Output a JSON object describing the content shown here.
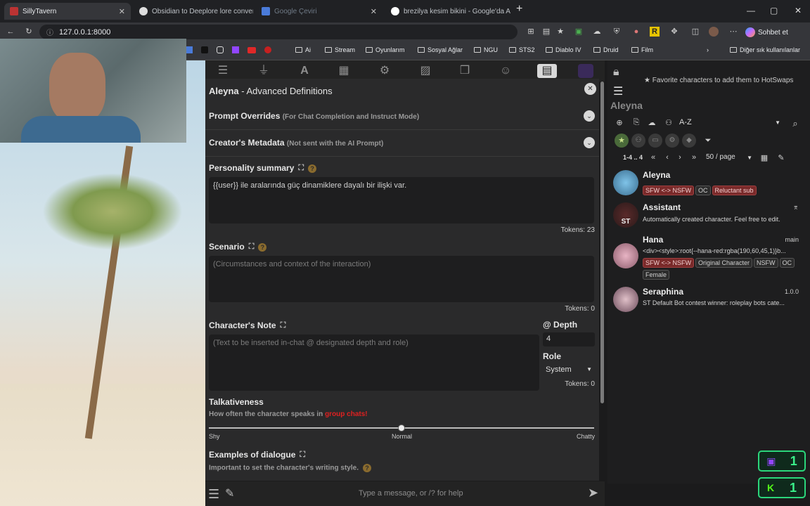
{
  "browser": {
    "tabs": [
      {
        "label": "SillyTavern",
        "active": true
      },
      {
        "label": "Obsidian to Deeplore lore convers",
        "active": false
      },
      {
        "label": "Google Çeviri",
        "active": false
      },
      {
        "label": "brezilya kesim bikini - Google'da A",
        "active": false
      }
    ],
    "url": "127.0.0.1:8000",
    "chat_button": "Sohbet et",
    "bookmarks": [
      "Ai",
      "Stream",
      "Oyunlarım",
      "Sosyal Ağlar",
      "NGU",
      "STS2",
      "Diablo IV",
      "Druid",
      "Film"
    ],
    "other_bookmarks": "Diğer sık kullanılanlar"
  },
  "editor": {
    "char_name": "Aleyna",
    "title_suffix": " - Advanced Definitions",
    "prompt_overrides": {
      "label": "Prompt Overrides",
      "sub": "(For Chat Completion and Instruct Mode)"
    },
    "creator_metadata": {
      "label": "Creator's Metadata",
      "sub": "(Not sent with the AI Prompt)"
    },
    "personality": {
      "label": "Personality summary",
      "value": "{{user}} ile aralarında güç dinamiklere dayalı bir ilişki var.",
      "tokens": "Tokens: 23"
    },
    "scenario": {
      "label": "Scenario",
      "placeholder": "(Circumstances and context of the interaction)",
      "tokens": "Tokens: 0"
    },
    "note": {
      "label": "Character's Note",
      "placeholder": "(Text to be inserted in-chat @ designated depth and role)",
      "tokens": "Tokens: 0"
    },
    "depth": {
      "label": "@ Depth",
      "value": "4"
    },
    "role": {
      "label": "Role",
      "value": "System"
    },
    "talkativeness": {
      "label": "Talkativeness",
      "hint": "How often the character speaks in ",
      "hint_link": "group chats!",
      "value": 0.5,
      "min_label": "Shy",
      "mid_label": "Normal",
      "max_label": "Chatty"
    },
    "examples": {
      "label": "Examples of dialogue",
      "hint": "Important to set the character's writing style."
    }
  },
  "chat_input": {
    "placeholder": "Type a message, or /? for help"
  },
  "right_panel": {
    "hotswap_hint": "Favorite characters to add them to HotSwaps",
    "current_name": "Aleyna",
    "sort": "A-Z",
    "pager": {
      "range": "1-4 .. 4",
      "per_page": "50 / page"
    },
    "characters": [
      {
        "name": "Aleyna",
        "desc": "",
        "tags": [
          {
            "label": "SFW <-> NSFW",
            "red": true
          },
          {
            "label": "OC",
            "red": false
          },
          {
            "label": "Reluctant sub",
            "red": true
          }
        ],
        "version": ""
      },
      {
        "name": "Assistant",
        "desc": "Automatically created character. Feel free to edit.",
        "tags": [],
        "version": ""
      },
      {
        "name": "Hana",
        "desc": "<div><style>:root{--hana-red:rgba(190,60,45,1)}b...",
        "tags": [
          {
            "label": "SFW <-> NSFW",
            "red": true
          },
          {
            "label": "Original Character",
            "red": false
          },
          {
            "label": "NSFW",
            "red": false
          },
          {
            "label": "OC",
            "red": false
          },
          {
            "label": "Female",
            "red": false
          }
        ],
        "version": "main"
      },
      {
        "name": "Seraphina",
        "desc": "ST Default Bot contest winner: roleplay bots cate...",
        "tags": [],
        "version": "1.0.0"
      }
    ]
  },
  "stream_widgets": [
    {
      "platform": "twitch-icon",
      "count": "1"
    },
    {
      "platform": "kick-icon",
      "count": "1"
    }
  ]
}
